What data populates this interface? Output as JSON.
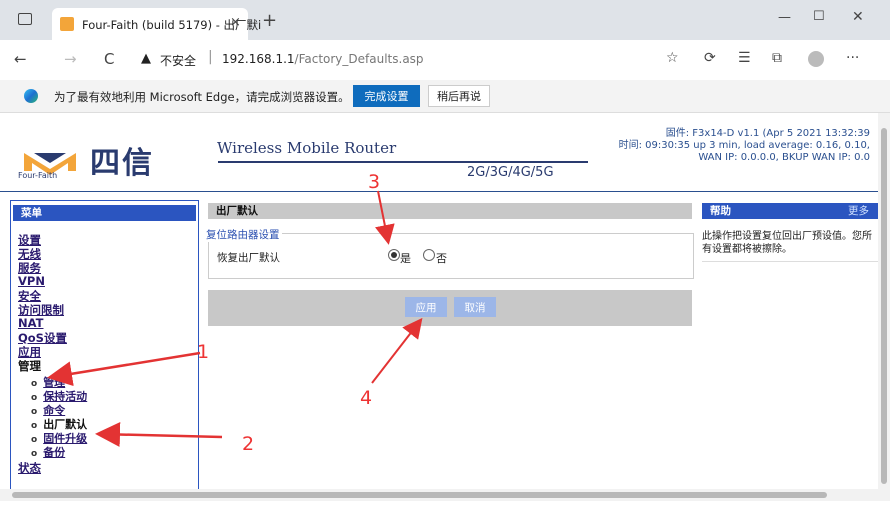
{
  "browser": {
    "tab_title": "Four-Faith (build 5179) - 出厂默i",
    "tab_close": "×",
    "new_tab": "+",
    "win_min": "—",
    "win_max": "☐",
    "win_close": "✕",
    "back": "←",
    "forward": "→",
    "reload": "C",
    "warning_icon": "▲",
    "insecure_label": "不安全",
    "url_host": "192.168.1.1",
    "url_path": "/Factory_Defaults.asp",
    "icons": [
      "favorite-add-icon",
      "extensions-icon",
      "favorites-icon",
      "collections-icon",
      "profile-icon",
      "more-icon"
    ]
  },
  "edge_bar": {
    "message": "为了最有效地利用 Microsoft Edge，请完成浏览器设置。",
    "complete_button": "完成设置",
    "later_button": "稍后再说"
  },
  "header": {
    "logo_cn": "四信",
    "logo_en": "Four-Faith",
    "product_name": "Wireless Mobile Router",
    "bands": "2G/3G/4G/5G",
    "firmware": "固件: F3x14-D v1.1 (Apr 5 2021 13:32:39",
    "time_line": "时间: 09:30:35 up 3 min, load average: 0.16, 0.10,",
    "wan_line": "WAN IP: 0.0.0.0, BKUP WAN IP: 0.0"
  },
  "menu": {
    "title": "菜单",
    "items": [
      "设置",
      "无线",
      "服务",
      "VPN",
      "安全",
      "访问限制",
      "NAT",
      "QoS设置",
      "应用",
      "管理"
    ],
    "sub_items": [
      "管理",
      "保持活动",
      "命令",
      "出厂默认",
      "固件升级",
      "备份"
    ],
    "last_item": "状态"
  },
  "main": {
    "section_title": "出厂默认",
    "legend": "复位路由器设置",
    "field_label": "恢复出厂默认",
    "option_yes": "是",
    "option_no": "否",
    "apply_button": "应用",
    "cancel_button": "取消"
  },
  "help": {
    "title": "帮助",
    "more": "更多",
    "text": "此操作把设置复位回出厂预设值。您所有设置都将被擦除。"
  },
  "annotations": {
    "n1": "1",
    "n2": "2",
    "n3": "3",
    "n4": "4",
    "color": "#e33333"
  }
}
